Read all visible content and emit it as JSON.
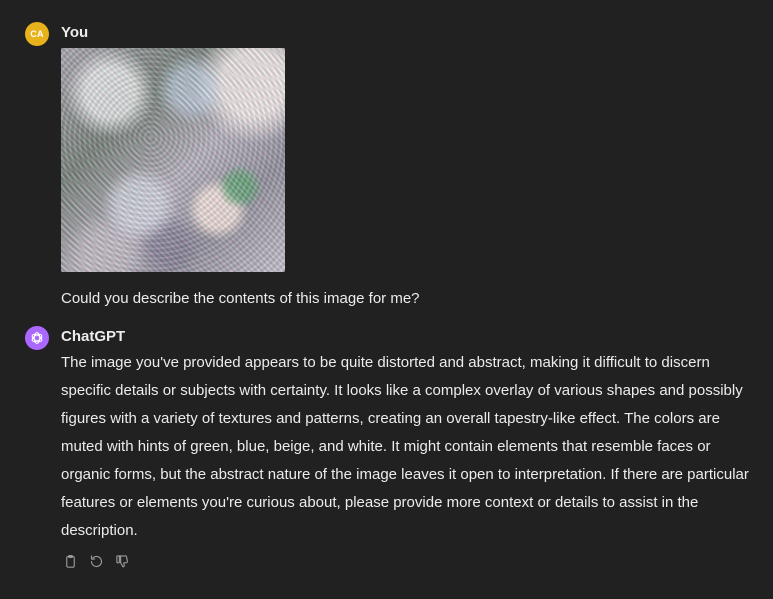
{
  "user_message": {
    "avatar_initials": "CA",
    "avatar_color": "#e8b21c",
    "author": "You",
    "image_icon": "uploaded-image",
    "text": "Could you describe the contents of this image for me?"
  },
  "assistant_message": {
    "avatar_icon": "openai-logo-icon",
    "avatar_color": "#ab68ff",
    "author": "ChatGPT",
    "text": "The image you've provided appears to be quite distorted and abstract, making it difficult to discern specific details or subjects with certainty. It looks like a complex overlay of various shapes and possibly figures with a variety of textures and patterns, creating an overall tapestry-like effect. The colors are muted with hints of green, blue, beige, and white. It might contain elements that resemble faces or organic forms, but the abstract nature of the image leaves it open to interpretation. If there are particular features or elements you're curious about, please provide more context or details to assist in the description."
  },
  "actions": {
    "copy_icon": "clipboard-icon",
    "regenerate_icon": "regenerate-icon",
    "dislike_icon": "thumbs-down-icon"
  },
  "theme": {
    "background": "#212121",
    "text": "#ececec",
    "icon": "#9b9b9b"
  }
}
